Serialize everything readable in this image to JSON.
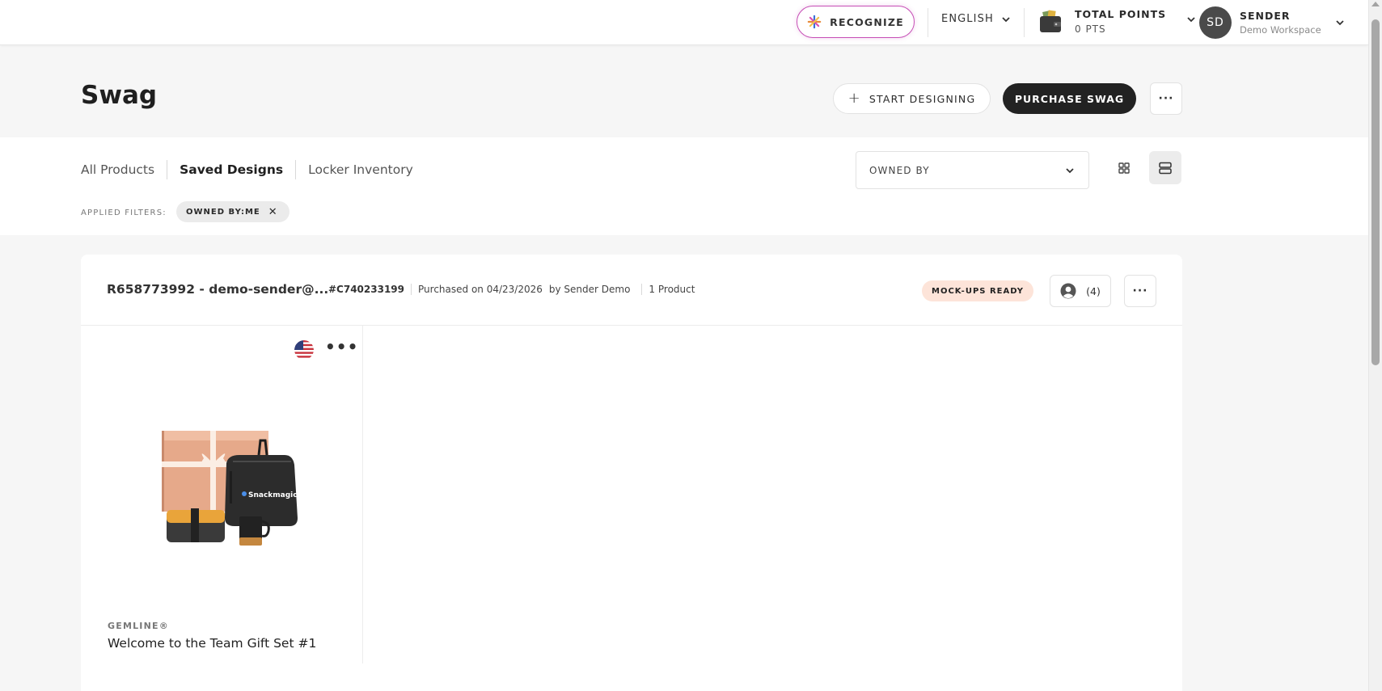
{
  "topbar": {
    "recognize_label": "RECOGNIZE",
    "language": "ENGLISH",
    "points_label": "TOTAL POINTS",
    "points_value": "0 PTS",
    "user_initials": "SD",
    "user_name": "SENDER",
    "workspace": "Demo Workspace"
  },
  "header": {
    "title": "Swag",
    "start_designing": "START DESIGNING",
    "purchase_swag": "PURCHASE SWAG",
    "more": "···"
  },
  "tabs": [
    {
      "label": "All Products",
      "active": false
    },
    {
      "label": "Saved Designs",
      "active": true
    },
    {
      "label": "Locker Inventory",
      "active": false
    }
  ],
  "filters": {
    "owned_by_label": "OWNED BY",
    "applied_label": "APPLIED FILTERS:",
    "chip": "OWNED BY:ME"
  },
  "card": {
    "title": "R658773992 - demo-sender@...",
    "code": "#C740233199",
    "purchased": "Purchased on 04/23/2026",
    "by": "by Sender Demo",
    "count": "1 Product",
    "status": "MOCK-UPS READY",
    "users_count": "(4)",
    "more": "···",
    "product": {
      "more": "•••",
      "brand": "GEMLINE®",
      "name": "Welcome to the Team Gift Set #1",
      "bag_logo": "Snackmagic"
    }
  },
  "colors": {
    "accent_pink": "#c64fb6",
    "dark_button": "#222222",
    "badge_bg": "#fde4d9"
  },
  "icons": [
    "spark-icon",
    "chevron-down-icon",
    "wallet-icon",
    "plus-icon",
    "grid-view-icon",
    "list-view-icon",
    "close-icon",
    "user-icon",
    "us-flag-icon",
    "more-icon"
  ]
}
